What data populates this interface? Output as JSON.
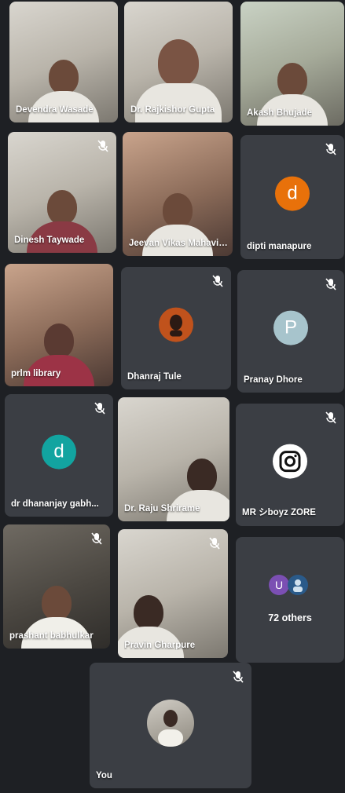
{
  "colors": {
    "background": "#1e2024",
    "tile": "#3b3e44",
    "avatar_dipti": "#e8710a",
    "avatar_pranay": "#a7c4cc",
    "avatar_dr_dhananjay": "#12a4a0",
    "avatar_others_u": "#7b4fb3"
  },
  "participants": [
    {
      "name": "Devendra Wasade",
      "muted": false,
      "video": true
    },
    {
      "name": "Dr. Rajkishor Gupta",
      "muted": false,
      "video": true
    },
    {
      "name": "Akash Bhujade",
      "muted": false,
      "video": true
    },
    {
      "name": "Dinesh Taywade",
      "muted": true,
      "video": true
    },
    {
      "name": "Jeevan Vikas Mahavidyalaya",
      "muted": false,
      "video": true
    },
    {
      "name": "dipti manapure",
      "muted": true,
      "video": false,
      "avatar_letter": "d"
    },
    {
      "name": "prlm library",
      "muted": false,
      "video": true
    },
    {
      "name": "Dhanraj Tule",
      "muted": true,
      "video": false,
      "avatar_icon": "profile-photo-icon"
    },
    {
      "name": "Pranay Dhore",
      "muted": true,
      "video": false,
      "avatar_letter": "P"
    },
    {
      "name": "dr dhananjay gabh...",
      "muted": true,
      "video": false,
      "avatar_letter": "d"
    },
    {
      "name": "Dr. Raju Shrirame",
      "muted": false,
      "video": true
    },
    {
      "name": "MR シboyz ZORE",
      "muted": true,
      "video": false,
      "avatar_icon": "camera-logo-icon"
    },
    {
      "name": "prashant babhulkar",
      "muted": true,
      "video": true
    },
    {
      "name": "Pravin Gharpure",
      "muted": true,
      "video": true
    },
    {
      "name": "72 others",
      "muted": false,
      "video": false,
      "avatar_letter": "U"
    },
    {
      "name": "You",
      "muted": true,
      "video": true
    }
  ],
  "icons": {
    "mic_muted": "mic-off-icon"
  }
}
